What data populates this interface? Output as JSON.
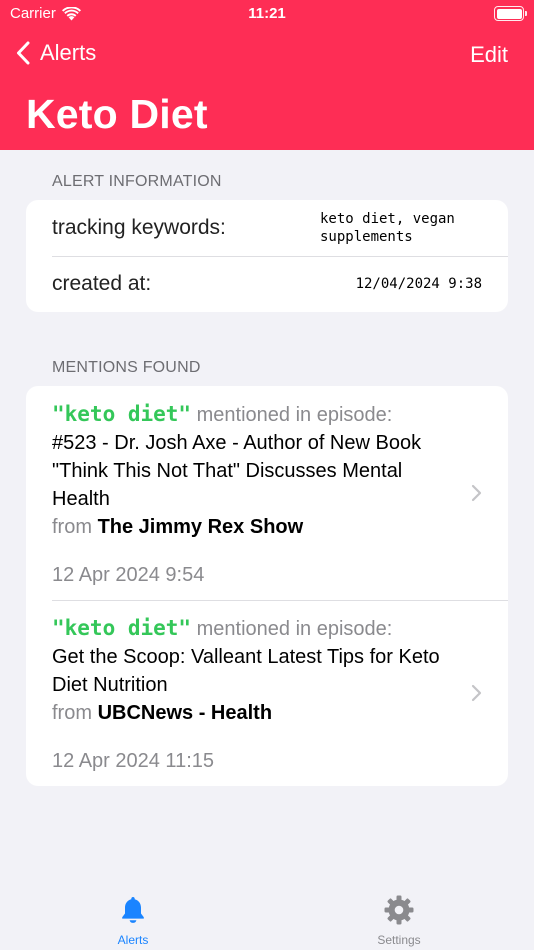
{
  "status_bar": {
    "carrier": "Carrier",
    "time": "11:21"
  },
  "nav": {
    "back_label": "Alerts",
    "edit_label": "Edit",
    "title": "Keto Diet"
  },
  "colors": {
    "header": "#fe2d55",
    "keyword": "#34c759",
    "tab_active": "#1a84ff",
    "muted": "#8a8a8e"
  },
  "alert_info": {
    "section_title": "ALERT INFORMATION",
    "keywords_label": "tracking keywords:",
    "keywords_value_line1": "keto diet, vegan",
    "keywords_value_line2": "supplements",
    "created_label": "created at:",
    "created_value": "12/04/2024 9:38"
  },
  "mentions": {
    "section_title": "MENTIONS FOUND",
    "items": [
      {
        "keyword": "\"keto diet\"",
        "mentioned_text": "mentioned in episode:",
        "episode": "#523 - Dr. Josh Axe - Author of New Book \"Think This Not That\" Discusses Mental Health",
        "from_text": "from",
        "show": "The Jimmy Rex Show",
        "date": "12 Apr 2024 9:54"
      },
      {
        "keyword": "\"keto diet\"",
        "mentioned_text": "mentioned in episode:",
        "episode": "Get the Scoop: Valleant Latest Tips for Keto Diet Nutrition",
        "from_text": "from",
        "show": "UBCNews - Health",
        "date": "12 Apr 2024 11:15"
      }
    ]
  },
  "tabbar": {
    "tabs": [
      {
        "label": "Alerts",
        "icon": "bell-icon",
        "active": true
      },
      {
        "label": "Settings",
        "icon": "gear-icon",
        "active": false
      }
    ]
  }
}
